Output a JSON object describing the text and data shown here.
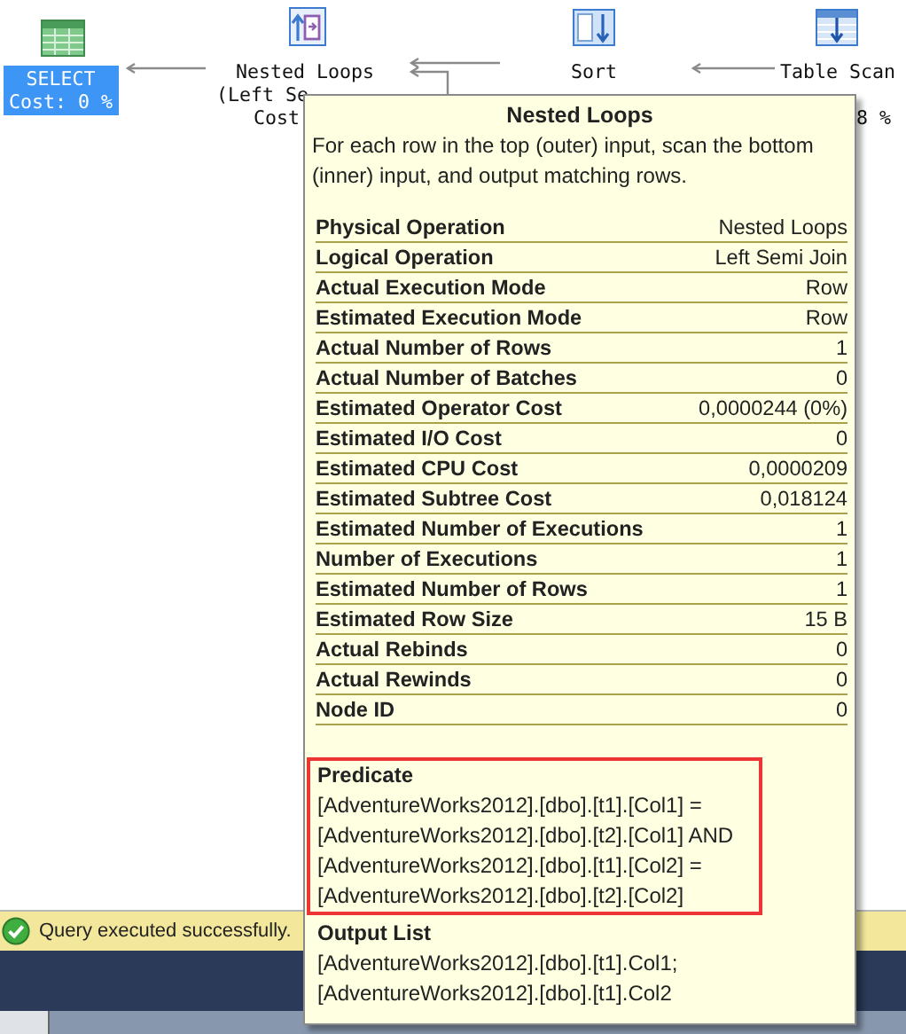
{
  "plan_nodes": [
    {
      "kind": "select",
      "label": "SELECT",
      "lines": [
        "Cost: 0 %"
      ],
      "selected": true
    },
    {
      "kind": "nested_loops",
      "label": "Nested Loops",
      "lines": [
        "(Left Se",
        "Cost"
      ],
      "selected": false
    },
    {
      "kind": "sort",
      "label": "Sort",
      "selected": false
    },
    {
      "kind": "table_scan",
      "label": "Table Scan",
      "lines": [
        "8 %"
      ],
      "selected": false
    }
  ],
  "tooltip": {
    "title": "Nested Loops",
    "description": "For each row in the top (outer) input, scan the bottom (inner) input, and output matching rows.",
    "properties": [
      {
        "name": "Physical Operation",
        "value": "Nested Loops"
      },
      {
        "name": "Logical Operation",
        "value": "Left Semi Join"
      },
      {
        "name": "Actual Execution Mode",
        "value": "Row"
      },
      {
        "name": "Estimated Execution Mode",
        "value": "Row"
      },
      {
        "name": "Actual Number of Rows",
        "value": "1"
      },
      {
        "name": "Actual Number of Batches",
        "value": "0"
      },
      {
        "name": "Estimated Operator Cost",
        "value": "0,0000244 (0%)"
      },
      {
        "name": "Estimated I/O Cost",
        "value": "0"
      },
      {
        "name": "Estimated CPU Cost",
        "value": "0,0000209"
      },
      {
        "name": "Estimated Subtree Cost",
        "value": "0,018124"
      },
      {
        "name": "Estimated Number of Executions",
        "value": "1"
      },
      {
        "name": "Number of Executions",
        "value": "1"
      },
      {
        "name": "Estimated Number of Rows",
        "value": "1"
      },
      {
        "name": "Estimated Row Size",
        "value": "15 B"
      },
      {
        "name": "Actual Rebinds",
        "value": "0"
      },
      {
        "name": "Actual Rewinds",
        "value": "0"
      },
      {
        "name": "Node ID",
        "value": "0"
      }
    ],
    "sections": [
      {
        "heading": "Predicate",
        "highlighted": true,
        "lines": [
          "[AdventureWorks2012].[dbo].[t1].[Col1] =",
          "[AdventureWorks2012].[dbo].[t2].[Col1] AND",
          "[AdventureWorks2012].[dbo].[t1].[Col2] =",
          "[AdventureWorks2012].[dbo].[t2].[Col2]"
        ]
      },
      {
        "heading": "Output List",
        "highlighted": false,
        "lines": [
          "[AdventureWorks2012].[dbo].[t1].Col1;",
          "[AdventureWorks2012].[dbo].[t1].Col2"
        ]
      }
    ]
  },
  "status_bar": {
    "kind": "success",
    "text": "Query executed successfully."
  }
}
